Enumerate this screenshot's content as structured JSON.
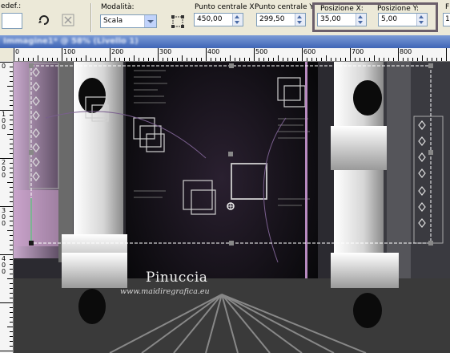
{
  "toolbar": {
    "preset_label": "edef.:",
    "mode": {
      "label": "Modalità:",
      "value": "Scala"
    },
    "center_x": {
      "label": "Punto centrale X:",
      "value": "450,00"
    },
    "center_y": {
      "label": "Punto centrale Y:",
      "value": "299,50"
    },
    "pos_x": {
      "label": "Posizione X:",
      "value": "35,00"
    },
    "pos_y": {
      "label": "Posizione Y:",
      "value": "5,00"
    },
    "partial_label": "F",
    "partial_value": "1"
  },
  "ruler_top": {
    "labels": [
      "0",
      "100",
      "200",
      "300",
      "400",
      "500",
      "600",
      "700",
      "800"
    ]
  },
  "ruler_left": {
    "labels": [
      "0",
      "1\n0\n0",
      "2\n0\n0",
      "3\n0\n0",
      "4\n0\n0"
    ]
  },
  "canvas": {
    "signature": "Pinuccia",
    "website": "www.maidiregrafica.eu",
    "accent_color": "#b88ac0"
  }
}
